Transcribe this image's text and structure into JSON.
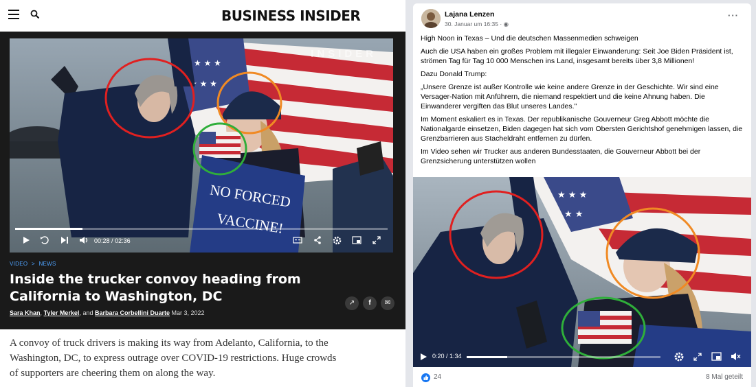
{
  "business_insider": {
    "logo": "BUSINESS INSIDER",
    "video": {
      "watermark": "INSIDER",
      "time_current": "00:28",
      "time_separator": "/",
      "time_total": "02:36",
      "progress": 0.18,
      "sign_line1": "NO FORCED",
      "sign_line2": "VACCINE!"
    },
    "breadcrumb": [
      "VIDEO",
      ">",
      "NEWS"
    ],
    "title": "Inside the trucker convoy heading from California to Washington, DC",
    "authors": [
      "Sara Khan",
      "Tyler Merkel",
      "Barbara Corbellini Duarte"
    ],
    "author_sep1": ",",
    "author_sep2": ", and",
    "date": "Mar 3, 2022",
    "body": "A convoy of truck drivers is making its way from Adelanto, California, to the Washington, DC, to express outrage over COVID-19 restrictions. Huge crowds of supporters are cheering them on along the way."
  },
  "facebook": {
    "author": "Lajana Lenzen",
    "timestamp": "30. Januar um 16:35",
    "timestamp_sep": "·",
    "more": "···",
    "paragraphs": [
      "High Noon in Texas – Und die deutschen Massenmedien schweigen",
      "Auch die USA haben ein großes Problem mit illegaler Einwanderung: Seit Joe Biden Präsident ist, strömen Tag für Tag 10 000 Menschen ins Land, insgesamt bereits über 3,8 Millionen!",
      "Dazu Donald Trump:",
      "„Unsere Grenze ist außer Kontrolle wie keine andere Grenze in der Geschichte. Wir sind eine Versager-Nation mit Anführern, die niemand respektiert und die keine Ahnung haben. Die Einwanderer vergiften das Blut unseres Landes.\"",
      "Im Moment eskaliert es in Texas. Der republikanische Gouverneur Greg Abbott möchte die Nationalgarde einsetzen, Biden dagegen hat sich vom Obersten Gerichtshof genehmigen lassen, die Grenzbarrieren aus Stacheldraht entfernen zu dürfen.",
      "Im Video sehen wir Trucker aus anderen Bundesstaaten, die Gouverneur Abbott bei der Grenzsicherung unterstützen wollen"
    ],
    "video": {
      "time": "0:20 / 1:34",
      "progress": 0.21
    },
    "likes": "24",
    "shares": "8 Mal geteilt"
  },
  "annotation_colors": {
    "red": "#e02020",
    "orange": "#f08a24",
    "green": "#2fae3a"
  },
  "colors": {
    "bi_dark_bg": "#1a1a1a",
    "bi_link_blue": "#4fa3ff",
    "fb_blue": "#1877f2",
    "fb_gray": "#65676b"
  }
}
